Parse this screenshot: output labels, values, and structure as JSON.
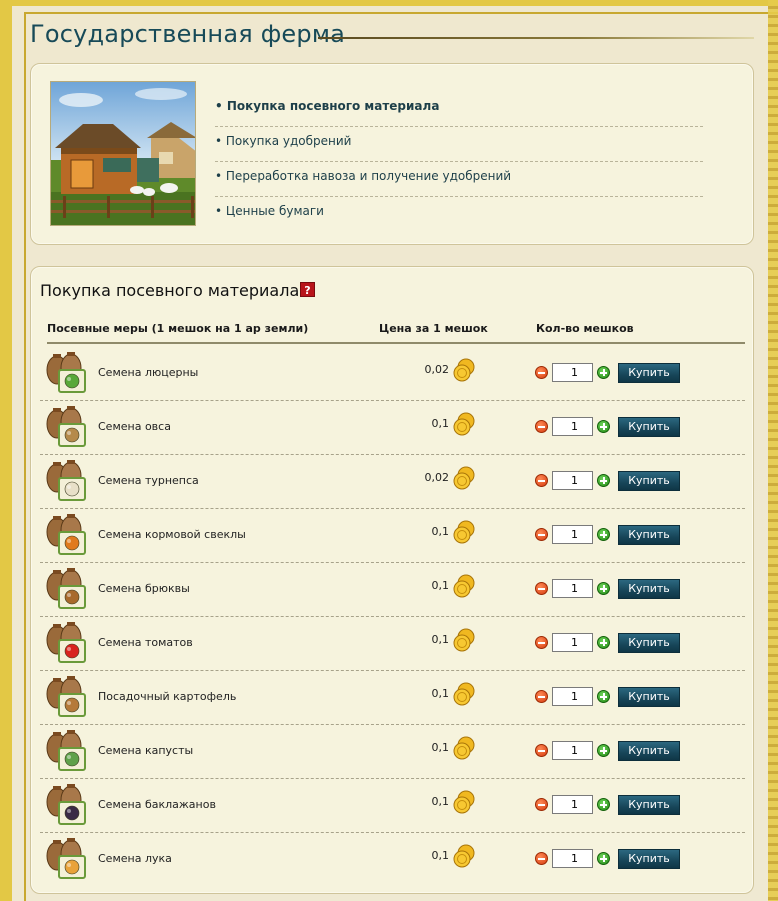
{
  "page": {
    "title": "Государственная ферма"
  },
  "nav": {
    "items": [
      {
        "label": "Покупка посевного материала",
        "active": true
      },
      {
        "label": "Покупка удобрений",
        "active": false
      },
      {
        "label": "Переработка навоза и получение удобрений",
        "active": false
      },
      {
        "label": "Ценные бумаги",
        "active": false
      }
    ]
  },
  "section": {
    "title": "Покупка посевного материала",
    "help_label": "?"
  },
  "table": {
    "headers": {
      "name": "Посевные меры (1 мешок на 1 ар земли)",
      "price": "Цена за 1 мешок",
      "qty": "Кол-во мешков"
    },
    "rows": [
      {
        "name": "Семена люцерны",
        "price": "0,02",
        "qty": "1",
        "buy": "Купить",
        "icon": "alfalfa-seed-icon",
        "icon_color": "#5aa83a"
      },
      {
        "name": "Семена овса",
        "price": "0,1",
        "qty": "1",
        "buy": "Купить",
        "icon": "oat-seed-icon",
        "icon_color": "#b58a4a"
      },
      {
        "name": "Семена турнепса",
        "price": "0,02",
        "qty": "1",
        "buy": "Купить",
        "icon": "turnip-seed-icon",
        "icon_color": "#e8e0c8"
      },
      {
        "name": "Семена кормовой свеклы",
        "price": "0,1",
        "qty": "1",
        "buy": "Купить",
        "icon": "fodder-beet-seed-icon",
        "icon_color": "#e07a1e"
      },
      {
        "name": "Семена брюквы",
        "price": "0,1",
        "qty": "1",
        "buy": "Купить",
        "icon": "rutabaga-seed-icon",
        "icon_color": "#a86a2c"
      },
      {
        "name": "Семена томатов",
        "price": "0,1",
        "qty": "1",
        "buy": "Купить",
        "icon": "tomato-seed-icon",
        "icon_color": "#d8231e"
      },
      {
        "name": "Посадочный картофель",
        "price": "0,1",
        "qty": "1",
        "buy": "Купить",
        "icon": "potato-seed-icon",
        "icon_color": "#b57a3a"
      },
      {
        "name": "Семена капусты",
        "price": "0,1",
        "qty": "1",
        "buy": "Купить",
        "icon": "cabbage-seed-icon",
        "icon_color": "#5fa04a"
      },
      {
        "name": "Семена баклажанов",
        "price": "0,1",
        "qty": "1",
        "buy": "Купить",
        "icon": "eggplant-seed-icon",
        "icon_color": "#3a2a45"
      },
      {
        "name": "Семена лука",
        "price": "0,1",
        "qty": "1",
        "buy": "Купить",
        "icon": "onion-seed-icon",
        "icon_color": "#e8a23a"
      }
    ]
  },
  "colors": {
    "title": "#174a58",
    "button": "#174659",
    "frame": "#e3c845"
  }
}
